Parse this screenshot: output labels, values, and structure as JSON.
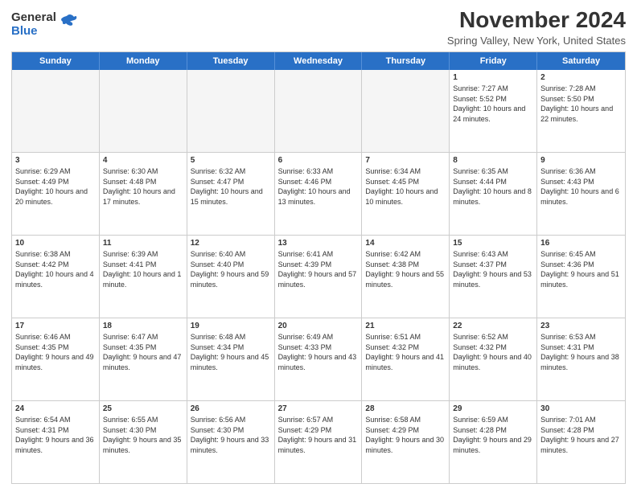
{
  "header": {
    "logo_line1": "General",
    "logo_line2": "Blue",
    "month_title": "November 2024",
    "location": "Spring Valley, New York, United States"
  },
  "calendar": {
    "days_of_week": [
      "Sunday",
      "Monday",
      "Tuesday",
      "Wednesday",
      "Thursday",
      "Friday",
      "Saturday"
    ],
    "rows": [
      [
        {
          "day": "",
          "info": ""
        },
        {
          "day": "",
          "info": ""
        },
        {
          "day": "",
          "info": ""
        },
        {
          "day": "",
          "info": ""
        },
        {
          "day": "",
          "info": ""
        },
        {
          "day": "1",
          "info": "Sunrise: 7:27 AM\nSunset: 5:52 PM\nDaylight: 10 hours and 24 minutes."
        },
        {
          "day": "2",
          "info": "Sunrise: 7:28 AM\nSunset: 5:50 PM\nDaylight: 10 hours and 22 minutes."
        }
      ],
      [
        {
          "day": "3",
          "info": "Sunrise: 6:29 AM\nSunset: 4:49 PM\nDaylight: 10 hours and 20 minutes."
        },
        {
          "day": "4",
          "info": "Sunrise: 6:30 AM\nSunset: 4:48 PM\nDaylight: 10 hours and 17 minutes."
        },
        {
          "day": "5",
          "info": "Sunrise: 6:32 AM\nSunset: 4:47 PM\nDaylight: 10 hours and 15 minutes."
        },
        {
          "day": "6",
          "info": "Sunrise: 6:33 AM\nSunset: 4:46 PM\nDaylight: 10 hours and 13 minutes."
        },
        {
          "day": "7",
          "info": "Sunrise: 6:34 AM\nSunset: 4:45 PM\nDaylight: 10 hours and 10 minutes."
        },
        {
          "day": "8",
          "info": "Sunrise: 6:35 AM\nSunset: 4:44 PM\nDaylight: 10 hours and 8 minutes."
        },
        {
          "day": "9",
          "info": "Sunrise: 6:36 AM\nSunset: 4:43 PM\nDaylight: 10 hours and 6 minutes."
        }
      ],
      [
        {
          "day": "10",
          "info": "Sunrise: 6:38 AM\nSunset: 4:42 PM\nDaylight: 10 hours and 4 minutes."
        },
        {
          "day": "11",
          "info": "Sunrise: 6:39 AM\nSunset: 4:41 PM\nDaylight: 10 hours and 1 minute."
        },
        {
          "day": "12",
          "info": "Sunrise: 6:40 AM\nSunset: 4:40 PM\nDaylight: 9 hours and 59 minutes."
        },
        {
          "day": "13",
          "info": "Sunrise: 6:41 AM\nSunset: 4:39 PM\nDaylight: 9 hours and 57 minutes."
        },
        {
          "day": "14",
          "info": "Sunrise: 6:42 AM\nSunset: 4:38 PM\nDaylight: 9 hours and 55 minutes."
        },
        {
          "day": "15",
          "info": "Sunrise: 6:43 AM\nSunset: 4:37 PM\nDaylight: 9 hours and 53 minutes."
        },
        {
          "day": "16",
          "info": "Sunrise: 6:45 AM\nSunset: 4:36 PM\nDaylight: 9 hours and 51 minutes."
        }
      ],
      [
        {
          "day": "17",
          "info": "Sunrise: 6:46 AM\nSunset: 4:35 PM\nDaylight: 9 hours and 49 minutes."
        },
        {
          "day": "18",
          "info": "Sunrise: 6:47 AM\nSunset: 4:35 PM\nDaylight: 9 hours and 47 minutes."
        },
        {
          "day": "19",
          "info": "Sunrise: 6:48 AM\nSunset: 4:34 PM\nDaylight: 9 hours and 45 minutes."
        },
        {
          "day": "20",
          "info": "Sunrise: 6:49 AM\nSunset: 4:33 PM\nDaylight: 9 hours and 43 minutes."
        },
        {
          "day": "21",
          "info": "Sunrise: 6:51 AM\nSunset: 4:32 PM\nDaylight: 9 hours and 41 minutes."
        },
        {
          "day": "22",
          "info": "Sunrise: 6:52 AM\nSunset: 4:32 PM\nDaylight: 9 hours and 40 minutes."
        },
        {
          "day": "23",
          "info": "Sunrise: 6:53 AM\nSunset: 4:31 PM\nDaylight: 9 hours and 38 minutes."
        }
      ],
      [
        {
          "day": "24",
          "info": "Sunrise: 6:54 AM\nSunset: 4:31 PM\nDaylight: 9 hours and 36 minutes."
        },
        {
          "day": "25",
          "info": "Sunrise: 6:55 AM\nSunset: 4:30 PM\nDaylight: 9 hours and 35 minutes."
        },
        {
          "day": "26",
          "info": "Sunrise: 6:56 AM\nSunset: 4:30 PM\nDaylight: 9 hours and 33 minutes."
        },
        {
          "day": "27",
          "info": "Sunrise: 6:57 AM\nSunset: 4:29 PM\nDaylight: 9 hours and 31 minutes."
        },
        {
          "day": "28",
          "info": "Sunrise: 6:58 AM\nSunset: 4:29 PM\nDaylight: 9 hours and 30 minutes."
        },
        {
          "day": "29",
          "info": "Sunrise: 6:59 AM\nSunset: 4:28 PM\nDaylight: 9 hours and 29 minutes."
        },
        {
          "day": "30",
          "info": "Sunrise: 7:01 AM\nSunset: 4:28 PM\nDaylight: 9 hours and 27 minutes."
        }
      ]
    ]
  }
}
